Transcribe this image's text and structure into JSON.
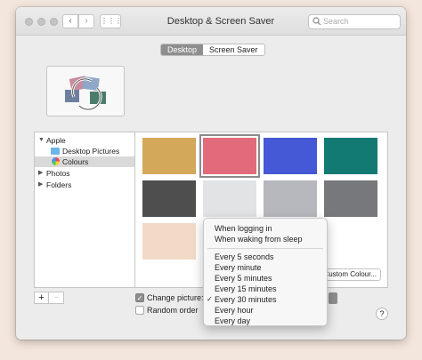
{
  "window": {
    "title": "Desktop & Screen Saver",
    "search_placeholder": "Search",
    "back_symbol": "‹",
    "forward_symbol": "›",
    "grid_symbol": "⋮⋮⋮"
  },
  "tabs": [
    {
      "label": "Desktop",
      "selected": true
    },
    {
      "label": "Screen Saver",
      "selected": false
    }
  ],
  "sidebar": {
    "items": [
      {
        "label": "Apple",
        "expanded": true,
        "triangle": "▼",
        "icon": "none"
      },
      {
        "label": "Desktop Pictures",
        "icon": "folder-icon"
      },
      {
        "label": "Colours",
        "icon": "colours-icon",
        "selected": true
      },
      {
        "label": "Photos",
        "expanded": false,
        "triangle": "▶"
      },
      {
        "label": "Folders",
        "expanded": false,
        "triangle": "▶"
      }
    ]
  },
  "swatches": [
    {
      "color": "#d4a85b"
    },
    {
      "color": "#e16b7a",
      "selected": true
    },
    {
      "color": "#4558d6"
    },
    {
      "color": "#127a72"
    },
    {
      "color": "#4e4e4e"
    },
    {
      "color": "#e2e3e5"
    },
    {
      "color": "#b6b8bd"
    },
    {
      "color": "#76787c"
    },
    {
      "color": "#f2dac8"
    }
  ],
  "controls": {
    "add_label": "+",
    "remove_label": "−",
    "change_picture_label": "Change picture:",
    "change_picture_checked": true,
    "random_order_label": "Random order",
    "random_order_checked": false,
    "custom_colour_label": "Custom Colour...",
    "help_label": "?"
  },
  "menu": {
    "group1": [
      "When logging in",
      "When waking from sleep"
    ],
    "group2": [
      "Every 5 seconds",
      "Every minute",
      "Every 5 minutes",
      "Every 15 minutes",
      "Every 30 minutes",
      "Every hour",
      "Every day"
    ],
    "checked_item": "Every 30 minutes",
    "check_mark": "✓"
  }
}
